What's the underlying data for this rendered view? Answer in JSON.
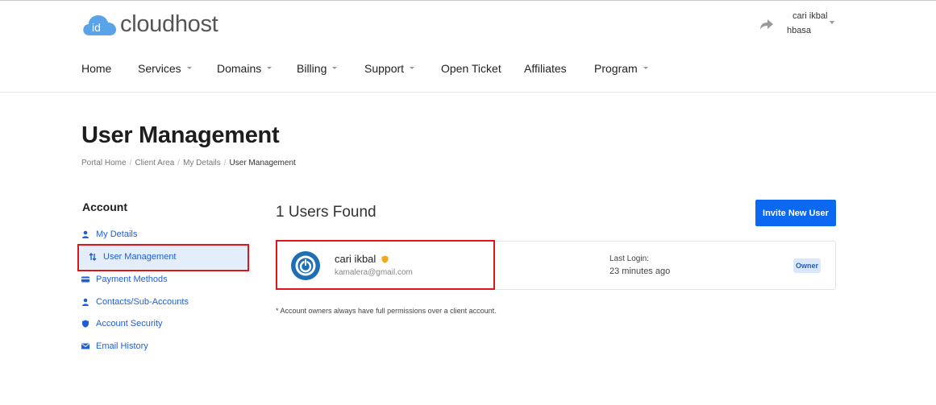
{
  "brand": {
    "logo_badge": "id",
    "logo_text": "cloudhost",
    "accent": "#0b68f0",
    "logo_color": "#5aa3e8"
  },
  "user_menu": {
    "name": "cari ikbal",
    "company": "hbasa"
  },
  "nav": {
    "items": [
      {
        "label": "Home",
        "dropdown": false
      },
      {
        "label": "Services",
        "dropdown": true
      },
      {
        "label": "Domains",
        "dropdown": true
      },
      {
        "label": "Billing",
        "dropdown": true
      },
      {
        "label": "Support",
        "dropdown": true
      },
      {
        "label": "Open Ticket",
        "dropdown": false
      },
      {
        "label": "Affiliates",
        "dropdown": false
      },
      {
        "label": "Program",
        "dropdown": true
      }
    ]
  },
  "page": {
    "title": "User Management",
    "breadcrumb": [
      "Portal Home",
      "Client Area",
      "My Details",
      "User Management"
    ]
  },
  "sidebar": {
    "title": "Account",
    "items": [
      {
        "label": "My Details",
        "icon": "user-icon",
        "active": false
      },
      {
        "label": "User Management",
        "icon": "sort-arrows-icon",
        "active": true
      },
      {
        "label": "Payment Methods",
        "icon": "credit-card-icon",
        "active": false
      },
      {
        "label": "Contacts/Sub-Accounts",
        "icon": "user-icon",
        "active": false
      },
      {
        "label": "Account Security",
        "icon": "shield-icon",
        "active": false
      },
      {
        "label": "Email History",
        "icon": "envelope-icon",
        "active": false
      }
    ]
  },
  "main": {
    "users_found": "1 Users Found",
    "invite_label": "Invite New User",
    "users": [
      {
        "name": "cari ikbal",
        "email": "kamalera@gmail.com",
        "last_login_label": "Last Login:",
        "last_login_value": "23 minutes ago",
        "role": "Owner"
      }
    ],
    "footnote": "* Account owners always have full permissions over a client account."
  }
}
